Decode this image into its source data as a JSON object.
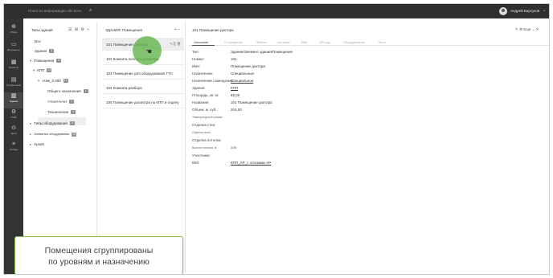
{
  "topbar": {
    "search_placeholder": "Поиск по информации обо всех",
    "search_icon": "search-icon",
    "user_name": "Андрей Барсуков",
    "user_chevron": "⌄"
  },
  "leftnav": {
    "items": [
      {
        "label": "Обзор",
        "icon": "circle-info-icon",
        "glyph": "⊕"
      },
      {
        "label": "Документы",
        "icon": "folder-icon",
        "glyph": "▭"
      },
      {
        "label": "Проекты",
        "icon": "grid-icon",
        "glyph": "▦"
      },
      {
        "label": "Справочники",
        "icon": "book-icon",
        "glyph": "▤"
      },
      {
        "label": "Здания",
        "icon": "building-icon",
        "glyph": "▥"
      },
      {
        "label": "ТОИР",
        "icon": "gear-icon",
        "glyph": "⚙"
      },
      {
        "label": "Цели",
        "icon": "target-icon",
        "glyph": "⊙"
      },
      {
        "label": "Склады",
        "icon": "stack-icon",
        "glyph": "≡"
      }
    ]
  },
  "col1": {
    "title": "Типы зданий",
    "tools": "☰ ⊞ ⚙ ⎯",
    "tree": [
      {
        "label": "Все",
        "badge": ""
      },
      {
        "label": "Здания",
        "badge": "4"
      },
      {
        "label": "Помещения",
        "badge": "3"
      },
      {
        "label": "КПП",
        "badge": "13"
      },
      {
        "label": "этаж_0.000",
        "badge": "13"
      },
      {
        "label": "Общего назначения",
        "badge": "1"
      },
      {
        "label": "Специальные",
        "badge": "1"
      },
      {
        "label": "Технические",
        "badge": "4"
      },
      {
        "label": "Типы оборудования",
        "badge": "4"
      },
      {
        "label": "Элементы оборудования",
        "badge": "10"
      },
      {
        "label": "Архив",
        "badge": ""
      }
    ]
  },
  "col2": {
    "title": "ЗДАНИЯ: Помещения",
    "tools": "+ ⎯",
    "items": [
      {
        "label": "101 Помещение доктора",
        "actions": "✎ ⎘ 🗑"
      },
      {
        "label": "102 Комната личного досмотра"
      },
      {
        "label": "103 Помещение для оборудования ГТС"
      },
      {
        "label": "104 Комната разбора"
      },
      {
        "label": "105 Помещение досмотра по КПП и отделу"
      }
    ]
  },
  "col3": {
    "title": "101 Помещение доктора",
    "tools": "✎ ⚙ Ещё ⌄ ✕",
    "tabs": [
      "Описание",
      "Отчуждение",
      "Файлы",
      "История",
      "BIM",
      "QR-код",
      "Оборудование",
      "Фото"
    ],
    "fields": [
      {
        "label": "Тип:",
        "value": "Здание/Элемент здания/Помещение"
      },
      {
        "label": "Номер:",
        "value": "101"
      },
      {
        "label": "Имя:",
        "value": "Помещение доктора"
      },
      {
        "label": "Назначение:",
        "value": "Специальные"
      },
      {
        "label": "Назначение помещения:",
        "value": "Специальное"
      },
      {
        "label": "Здание:",
        "value": "КПП"
      },
      {
        "label": "Площадь, кв. м:",
        "value": "68,00"
      },
      {
        "label": "Название:",
        "value": "101 Помещение доктора"
      },
      {
        "label": "Объем, м. куб.:",
        "value": "204,00"
      },
      {
        "label": "Температурный режим:",
        "value": ""
      },
      {
        "label": "Отделка стен:",
        "value": ""
      },
      {
        "label": "Отделка пола:",
        "value": ""
      },
      {
        "label": "Отделка потолка:",
        "value": ""
      },
      {
        "label": "Высота потолка, м:",
        "value": "3,00"
      },
      {
        "label": "Участники:",
        "value": ""
      },
      {
        "label": "BIM:",
        "value": "КПП_АР_с отсеками АР"
      }
    ]
  },
  "caption": {
    "line1": "Помещения сгруппированы",
    "line2": "по уровням и назначению"
  }
}
